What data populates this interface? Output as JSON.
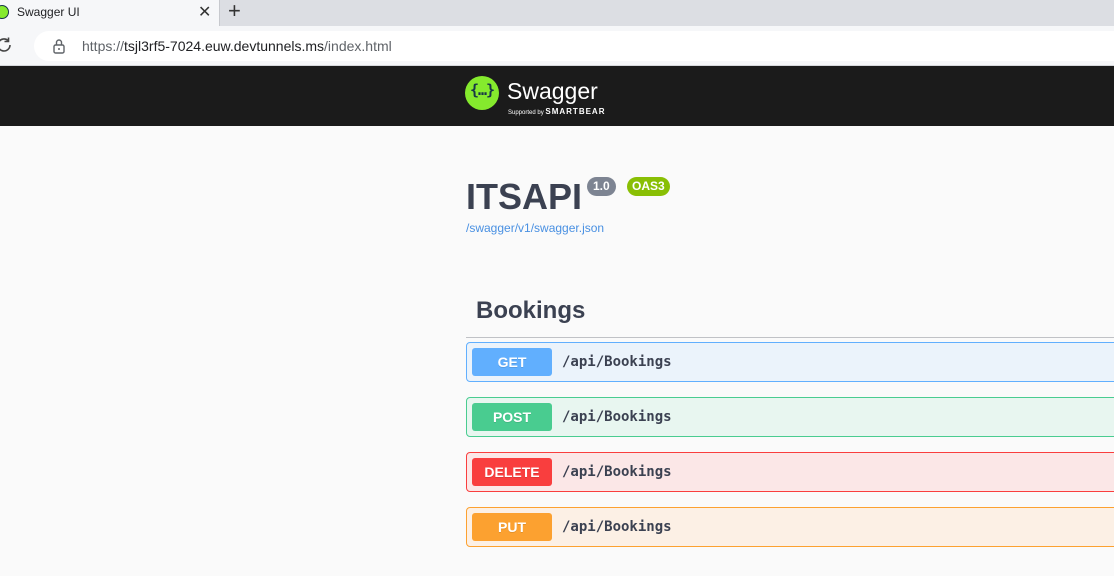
{
  "browser": {
    "tab_title": "Swagger UI",
    "tab_close": "✕",
    "new_tab": "+",
    "url_prefix": "https://",
    "url_host": "tsjl3rf5-7024.euw.devtunnels.ms",
    "url_path": "/index.html"
  },
  "topbar": {
    "brand": "Swagger",
    "logo_glyph": "{…}",
    "supported_by": "Supported by",
    "smartbear": "SMARTBEAR",
    "logo_color": "#85ea2d"
  },
  "info": {
    "title": "ITSAPI",
    "version": "1.0",
    "oas_badge": "OAS3",
    "spec_link": "/swagger/v1/swagger.json"
  },
  "tag": {
    "name": "Bookings"
  },
  "operations": [
    {
      "method": "GET",
      "path": "/api/Bookings",
      "color": "#61affe"
    },
    {
      "method": "POST",
      "path": "/api/Bookings",
      "color": "#49cc90"
    },
    {
      "method": "DELETE",
      "path": "/api/Bookings",
      "color": "#f93e3e"
    },
    {
      "method": "PUT",
      "path": "/api/Bookings",
      "color": "#fca130"
    }
  ]
}
